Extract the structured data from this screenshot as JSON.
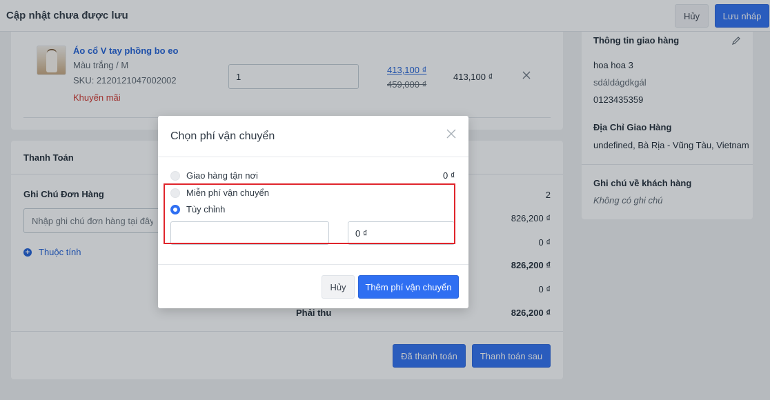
{
  "header": {
    "title": "Cập nhật chưa được lưu",
    "cancel_label": "Hủy",
    "save_draft_label": "Lưu nháp"
  },
  "product": {
    "name": "Áo cổ V tay phồng bo eo",
    "variant": "Màu trắng / M",
    "sku": "SKU: 2120121047002002",
    "promo_label": "Khuyến mãi",
    "quantity": "1",
    "sale_price": "413,100 ₫",
    "original_price": "459,000 ₫",
    "line_total": "413,100 ₫"
  },
  "payment": {
    "title": "Thanh Toán",
    "note_label": "Ghi Chú Đơn Hàng",
    "note_placeholder": "Nhập ghi chú đơn hàng tại đây",
    "attributes_link": "Thuộc tính",
    "item_count": "2",
    "subtotal": "826,200 ₫",
    "shipping": "0 ₫",
    "total": "826,200 ₫",
    "discount": "0 ₫",
    "amount_due_label": "Phải thu",
    "amount_due": "826,200 ₫",
    "paid_button": "Đã thanh toán",
    "pay_later_button": "Thanh toán sau"
  },
  "customer": {
    "shipping_info_title": "Thông tin giao hàng",
    "name": "hoa hoa 3",
    "email": "sdáldágdkgál",
    "phone": "0123435359",
    "address_title": "Địa Chỉ Giao Hàng",
    "address": "undefined, Bà Rịa - Vũng Tàu, Vietnam",
    "note_title": "Ghi chú về khách hàng",
    "note_value": "Không có ghi chú"
  },
  "modal": {
    "title": "Chọn phí vận chuyển",
    "options": [
      {
        "label": "Giao hàng tận nơi",
        "price": "0 ₫",
        "selected": false
      },
      {
        "label": "Miễn phí vận chuyển",
        "selected": false
      },
      {
        "label": "Tùy chỉnh",
        "selected": true
      }
    ],
    "custom_name_value": "",
    "custom_fee_value": "0 ₫",
    "cancel_label": "Hủy",
    "confirm_label": "Thêm phí vận chuyển"
  },
  "colors": {
    "primary": "#2f6ff2",
    "link": "#1f5fd6",
    "promo": "#d0342c",
    "highlight": "#e0242b"
  },
  "icons": {
    "close": "close-icon",
    "remove": "remove-icon",
    "edit": "pencil-icon",
    "add": "plus-circle-icon"
  }
}
